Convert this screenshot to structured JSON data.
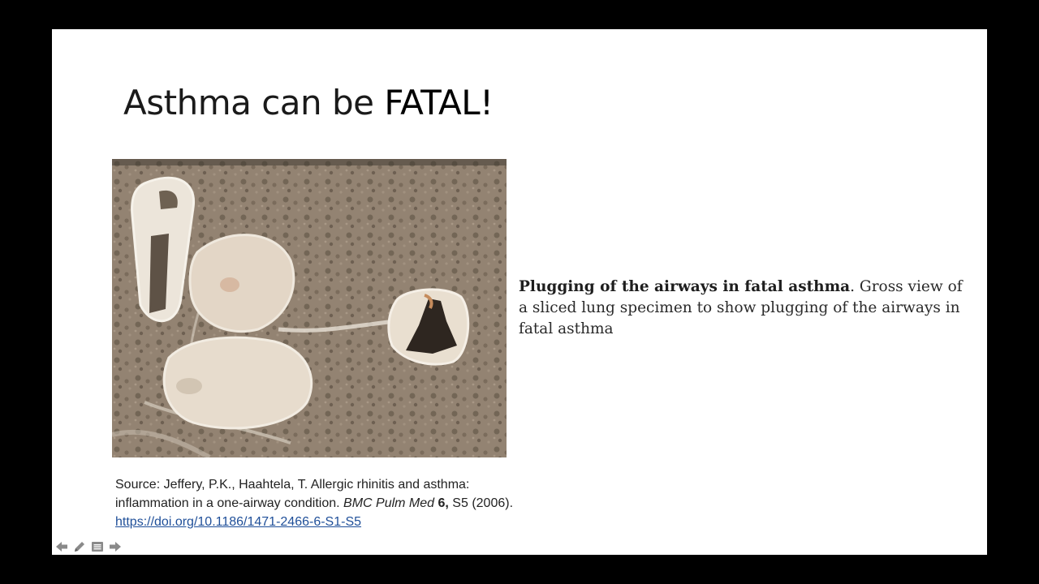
{
  "slide": {
    "title_plain": "Asthma can be ",
    "title_emphasis": "FATAL!",
    "caption_lead": "Plugging of the airways in fatal asthma",
    "caption_body": ". Gross view of a sliced lung specimen to show plugging of the airways in fatal asthma",
    "source": {
      "prefix": "Source: Jeffery, P.K., Haahtela, T. Allergic rhinitis and asthma: inflammation in a one-airway condition. ",
      "journal": "BMC Pulm Med",
      "volume": " 6,",
      "pages": " S5 (2006). ",
      "link": "https://doi.org/10.1186/1471-2466-6-S1-S5"
    }
  },
  "nav_icons": [
    "previous-slide-icon",
    "pen-icon",
    "slide-menu-icon",
    "next-slide-icon"
  ],
  "colors": {
    "background": "#000000",
    "slide": "#ffffff",
    "link": "#1f4f99"
  }
}
